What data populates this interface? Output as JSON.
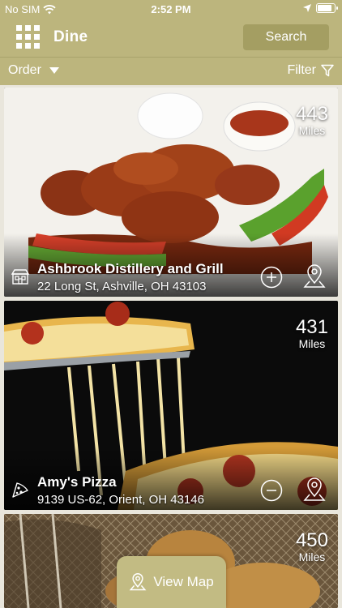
{
  "status_bar": {
    "carrier": "No SIM",
    "time": "2:52 PM"
  },
  "navbar": {
    "title": "Dine",
    "search_label": "Search"
  },
  "toolbar": {
    "order_label": "Order",
    "filter_label": "Filter"
  },
  "restaurants": [
    {
      "distance": "443",
      "unit": "Miles",
      "name": "Ashbrook Distillery and Grill",
      "address": "22 Long St, Ashville, OH 43103",
      "action": "add"
    },
    {
      "distance": "431",
      "unit": "Miles",
      "name": "Amy's Pizza",
      "address": "9139 US-62, Orient, OH 43146",
      "action": "remove"
    },
    {
      "distance": "450",
      "unit": "Miles"
    }
  ],
  "view_map_label": "View Map",
  "colors": {
    "brand": "#bcb57d",
    "brand_dark": "#a49e62",
    "text_light": "#ffffff"
  },
  "icons": {
    "menu": "grid-menu-icon",
    "wifi": "wifi-icon",
    "location_arrow": "location-arrow-icon",
    "battery": "battery-icon",
    "dropdown": "caret-down-icon",
    "filter": "funnel-icon",
    "restaurant": "restaurant-icon",
    "pizza": "pizza-icon",
    "add": "plus-circle-icon",
    "remove": "minus-circle-icon",
    "directions": "map-pin-icon",
    "map": "map-pin-icon"
  }
}
